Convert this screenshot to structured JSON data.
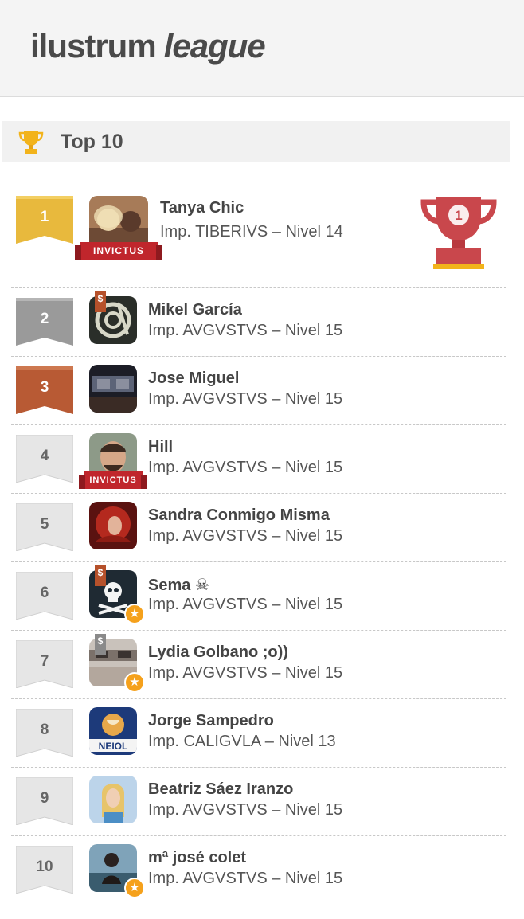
{
  "app": {
    "logo_part_1": "ilustrum",
    "logo_part_2": "league"
  },
  "section": {
    "title": "Top 10"
  },
  "colors": {
    "gold": "#e8b93d",
    "silver": "#9a9a9a",
    "bronze": "#b85a34",
    "invictus_red": "#c0262c"
  },
  "ranking": [
    {
      "rank": "1",
      "name": "Tanya Chic",
      "info": "Imp. TIBERIVS – Nivel 14",
      "badge": "INVICTUS"
    },
    {
      "rank": "2",
      "name": "Mikel García",
      "info": "Imp. AVGVSTVS – Nivel 15",
      "bookmark": "$"
    },
    {
      "rank": "3",
      "name": "Jose Miguel",
      "info": "Imp. AVGVSTVS – Nivel 15"
    },
    {
      "rank": "4",
      "name": "Hill",
      "info": "Imp. AVGVSTVS – Nivel 15",
      "badge": "INVICTUS"
    },
    {
      "rank": "5",
      "name": "Sandra Conmigo Misma",
      "info": "Imp. AVGVSTVS – Nivel 15"
    },
    {
      "rank": "6",
      "name": "Sema ☠",
      "info": "Imp. AVGVSTVS – Nivel 15",
      "bookmark": "$"
    },
    {
      "rank": "7",
      "name": "Lydia Golbano ;o))",
      "info": "Imp. AVGVSTVS – Nivel 15",
      "bookmark": "$"
    },
    {
      "rank": "8",
      "name": "Jorge Sampedro",
      "info": "Imp. CALIGVLA – Nivel 13",
      "avatar_text": "NEIOL"
    },
    {
      "rank": "9",
      "name": "Beatriz Sáez Iranzo",
      "info": "Imp. AVGVSTVS – Nivel 15"
    },
    {
      "rank": "10",
      "name": "mª josé colet",
      "info": "Imp. AVGVSTVS – Nivel 15"
    }
  ],
  "icons": {
    "section_icon": "trophy-icon",
    "winner_icon": "trophy-rank-1-icon",
    "star": "star-icon"
  }
}
